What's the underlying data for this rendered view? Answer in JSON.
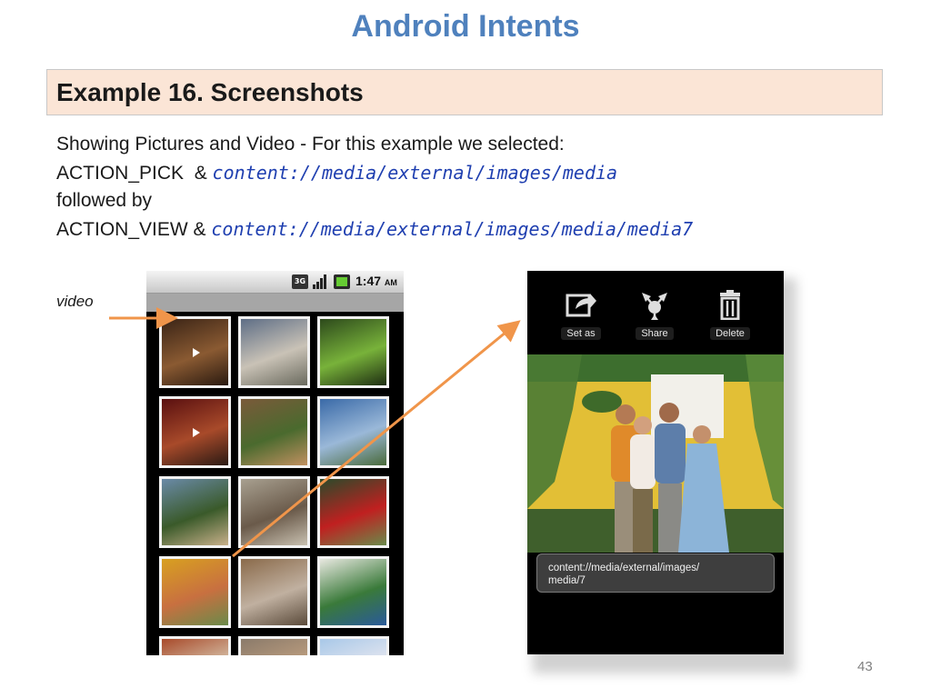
{
  "slide": {
    "title": "Android  Intents",
    "example_title": "Example 16.  Screenshots",
    "page_number": "43",
    "video_label": "video"
  },
  "description": {
    "line1": "Showing Pictures and Video - For this example we selected:",
    "line2_prefix": "ACTION_PICK  & ",
    "line2_uri": "content://media/external/images/media",
    "line3": "followed by",
    "line4_prefix": "ACTION_VIEW & ",
    "line4_uri": "content://media/external/images/media/media7"
  },
  "gallery_phone": {
    "status_time": "1:47",
    "status_ampm": "AM",
    "status_network": "3G",
    "thumbnails": [
      {
        "name": "video-thumb-1",
        "colors": [
          "#3a2416",
          "#8a5a32",
          "#2a1a10"
        ],
        "video": true
      },
      {
        "name": "street-thumb",
        "colors": [
          "#5e6e86",
          "#c9c2b6",
          "#6a6a5e"
        ],
        "video": false
      },
      {
        "name": "android-thumb",
        "colors": [
          "#2d4a1c",
          "#78b23a",
          "#1e2e12"
        ],
        "video": false
      },
      {
        "name": "video-thumb-2",
        "colors": [
          "#5a1010",
          "#a84a2a",
          "#2a1a14"
        ],
        "video": true
      },
      {
        "name": "people-thumb-1",
        "colors": [
          "#7a5a3a",
          "#4a6a2e",
          "#c09060"
        ],
        "video": false
      },
      {
        "name": "sky-thumb-1",
        "colors": [
          "#3a6aa8",
          "#9ab8d8",
          "#4a6a3a"
        ],
        "video": false
      },
      {
        "name": "beach-thumb",
        "colors": [
          "#6a8aa8",
          "#3a5a2a",
          "#c8b08a"
        ],
        "video": false
      },
      {
        "name": "building-thumb",
        "colors": [
          "#a8a090",
          "#6a5a4a",
          "#c8c0b0"
        ],
        "video": false
      },
      {
        "name": "golfer-thumb",
        "colors": [
          "#2a4a2a",
          "#c02020",
          "#6a8a4a"
        ],
        "video": false
      },
      {
        "name": "family-thumb",
        "colors": [
          "#d8a020",
          "#c87040",
          "#6a8a4a"
        ],
        "video": false
      },
      {
        "name": "group-thumb",
        "colors": [
          "#8a6a4a",
          "#c0b0a0",
          "#5a4a3a"
        ],
        "video": false
      },
      {
        "name": "golf-thumb",
        "colors": [
          "#e8e8e0",
          "#3a7a3a",
          "#2a5a9a"
        ],
        "video": false
      },
      {
        "name": "house-thumb",
        "colors": [
          "#a84a2a",
          "#d8c8b0",
          "#6a5a4a"
        ],
        "video": false
      },
      {
        "name": "crowd-thumb",
        "colors": [
          "#8a7a6a",
          "#c0a080",
          "#4a3a2a"
        ],
        "video": false
      },
      {
        "name": "sky-thumb-2",
        "colors": [
          "#a8c8e8",
          "#e8e8f0",
          "#7a9ab8"
        ],
        "video": false
      }
    ]
  },
  "viewer_phone": {
    "actions": [
      {
        "label": "Set as",
        "icon": "set-as-icon"
      },
      {
        "label": "Share",
        "icon": "share-icon"
      },
      {
        "label": "Delete",
        "icon": "trash-icon"
      }
    ],
    "uri_line1": "content://media/external/images/",
    "uri_line2": "media/7"
  },
  "colors": {
    "title": "#4f81bd",
    "example_box": "#fbe5d6",
    "uri_text": "#1f3fb0",
    "arrow": "#f0954a"
  }
}
